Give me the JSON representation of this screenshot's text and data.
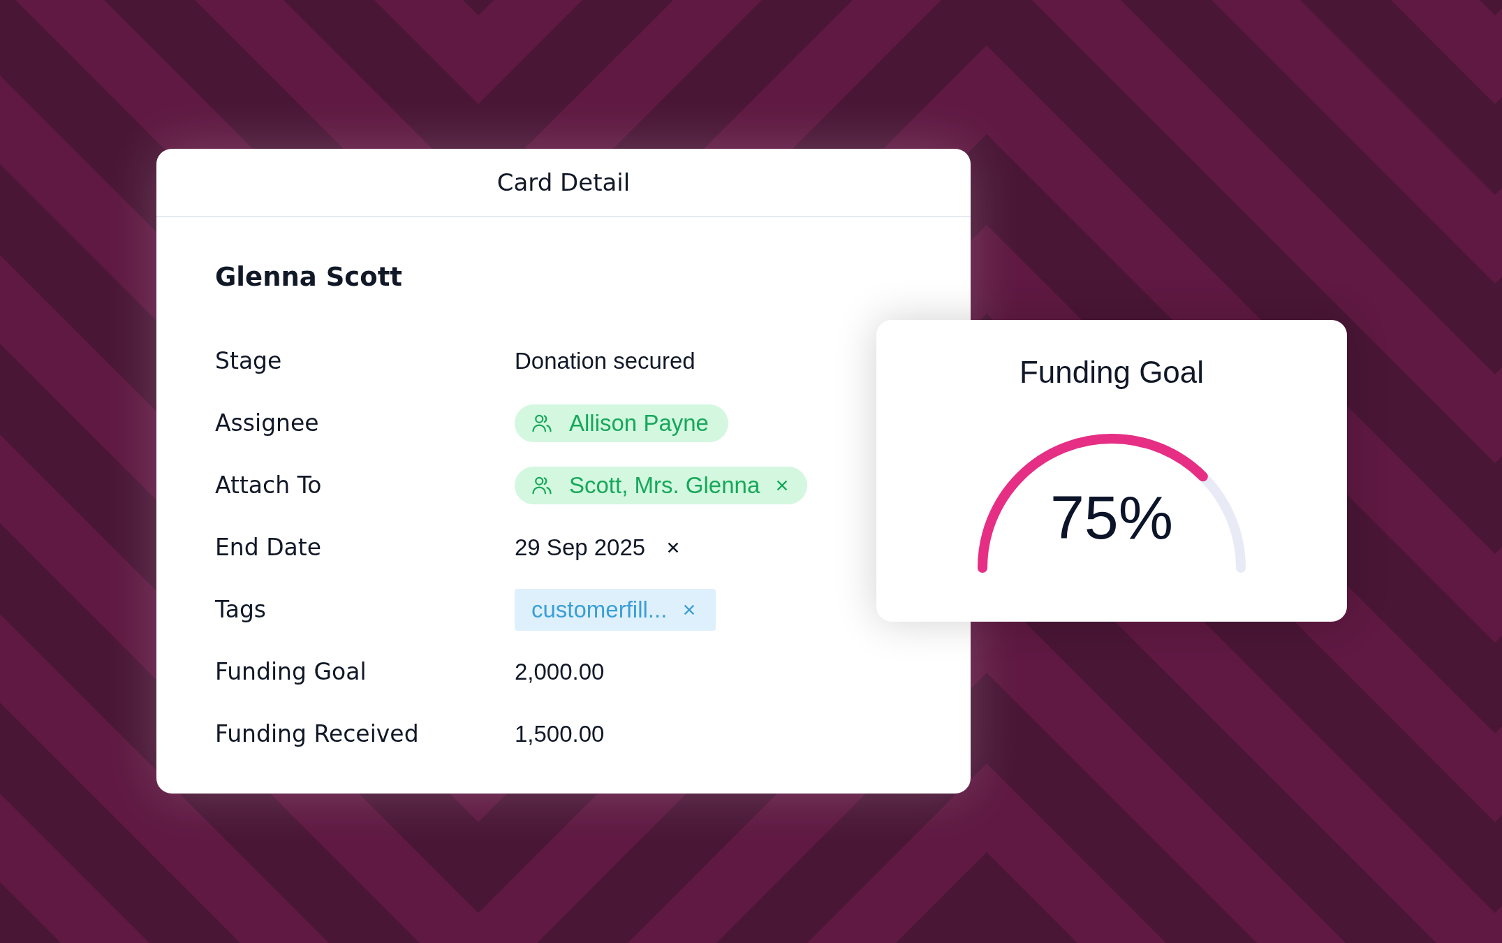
{
  "card": {
    "title": "Card Detail",
    "name": "Glenna Scott",
    "fields": [
      {
        "label": "Stage",
        "kind": "text",
        "value": "Donation secured"
      },
      {
        "label": "Assignee",
        "kind": "person",
        "value": "Allison Payne",
        "removable": false
      },
      {
        "label": "Attach To",
        "kind": "person",
        "value": "Scott, Mrs. Glenna",
        "removable": true
      },
      {
        "label": "End Date",
        "kind": "date",
        "value": "29 Sep 2025",
        "removable": true
      },
      {
        "label": "Tags",
        "kind": "tag",
        "value": "customerfill...",
        "removable": true
      },
      {
        "label": "Funding Goal",
        "kind": "text",
        "value": "2,000.00"
      },
      {
        "label": "Funding Received",
        "kind": "text",
        "value": "1,500.00"
      }
    ]
  },
  "gauge": {
    "title": "Funding Goal",
    "reading": "75%"
  }
}
